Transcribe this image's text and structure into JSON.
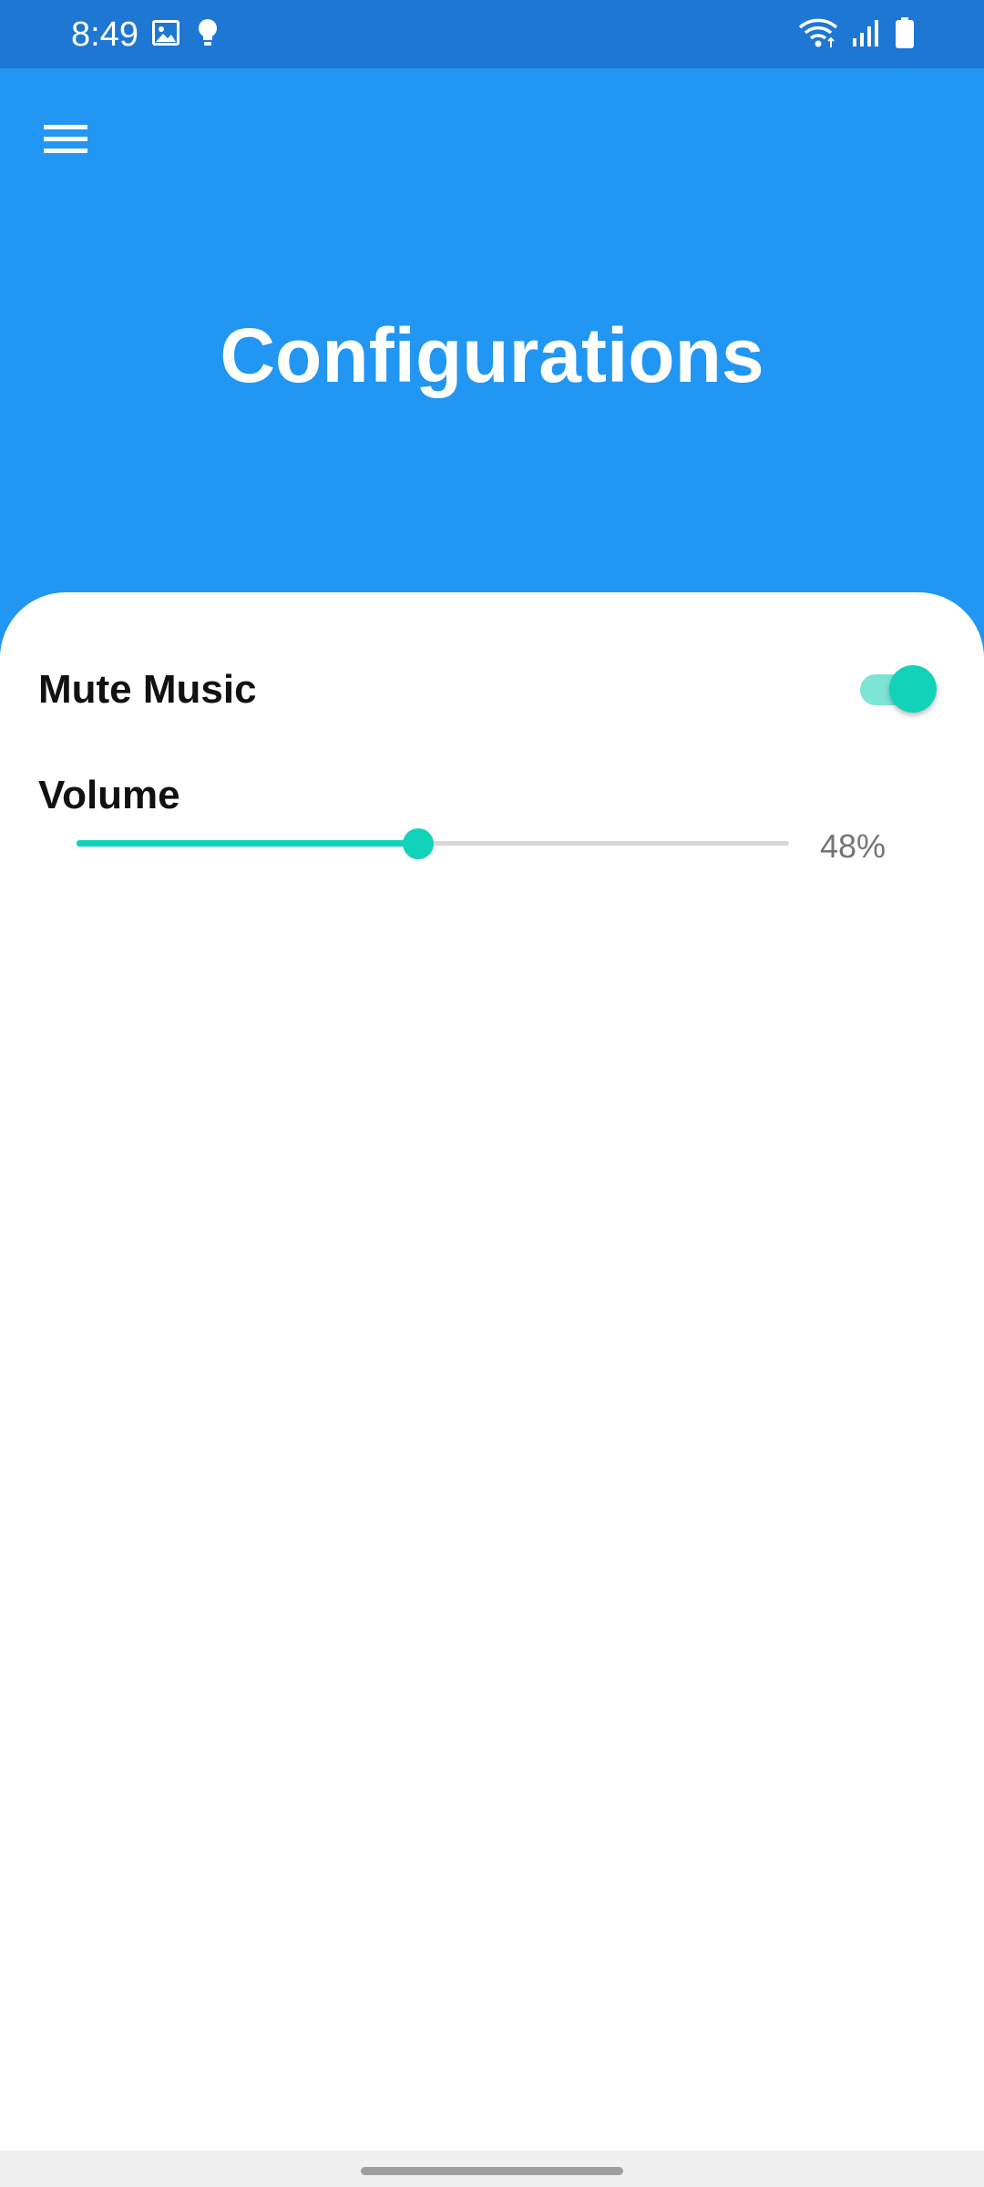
{
  "status_bar": {
    "time": "8:49",
    "left_icons": [
      "image-icon",
      "bulb-icon"
    ],
    "right_icons": [
      "wifi-icon",
      "signal-icon",
      "battery-icon"
    ],
    "color": "#1e77d2"
  },
  "header": {
    "title": "Configurations",
    "color": "#2196f3",
    "menu_icon": "hamburger-menu-icon"
  },
  "settings": {
    "mute_music": {
      "label": "Mute Music",
      "enabled": true
    },
    "volume": {
      "label": "Volume",
      "value": 48,
      "value_text": "48%"
    }
  },
  "colors": {
    "accent": "#12d2b9",
    "accent_light": "#7de5d6",
    "track": "#d9d9d9",
    "value_text": "#757575"
  }
}
